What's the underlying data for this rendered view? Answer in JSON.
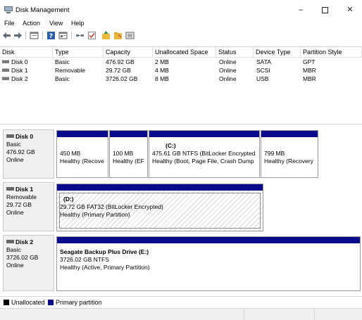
{
  "window": {
    "title": "Disk Management",
    "controls": {
      "minimize": "–",
      "close": "✕"
    }
  },
  "menu": [
    "File",
    "Action",
    "View",
    "Help"
  ],
  "toolbar": {
    "icons": [
      "back-arrow-icon",
      "forward-arrow-icon",
      "console-tree-icon",
      "help-icon",
      "properties-icon",
      "connect-icon",
      "check-icon",
      "folder-up-icon",
      "folder-icon",
      "list-view-icon"
    ]
  },
  "table": {
    "columns": [
      "Disk",
      "Type",
      "Capacity",
      "Unallocated Space",
      "Status",
      "Device Type",
      "Partition Style"
    ],
    "rows": [
      [
        "Disk 0",
        "Basic",
        "476.92 GB",
        "2 MB",
        "Online",
        "SATA",
        "GPT"
      ],
      [
        "Disk 1",
        "Removable",
        "29.72 GB",
        "4 MB",
        "Online",
        "SCSI",
        "MBR"
      ],
      [
        "Disk 2",
        "Basic",
        "3726.02 GB",
        "8 MB",
        "Online",
        "USB",
        "MBR"
      ]
    ]
  },
  "disks": [
    {
      "name": "Disk 0",
      "type": "Basic",
      "size": "476.92 GB",
      "status": "Online",
      "partitions": [
        {
          "title": "",
          "line1": "450 MB",
          "line2": "Healthy (Recove"
        },
        {
          "title": "",
          "line1": "100 MB",
          "line2": "Healthy (EF"
        },
        {
          "title": "(C:)",
          "line1": "475.61 GB NTFS (BitLocker Encrypted",
          "line2": "Healthy (Boot, Page File, Crash Dump"
        },
        {
          "title": "",
          "line1": "799 MB",
          "line2": "Healthy (Recovery"
        }
      ]
    },
    {
      "name": "Disk 1",
      "type": "Removable",
      "size": "29.72 GB",
      "status": "Online",
      "partitions": [
        {
          "title": "(D:)",
          "line1": "29.72 GB FAT32 (BitLocker Encrypted)",
          "line2": "Healthy (Primary Partition)"
        }
      ]
    },
    {
      "name": "Disk 2",
      "type": "Basic",
      "size": "3726.02 GB",
      "status": "Online",
      "partitions": [
        {
          "title": "Seagate Backup Plus Drive  (E:)",
          "line1": "3726.02 GB NTFS",
          "line2": "Healthy (Active, Primary Partition)"
        }
      ]
    }
  ],
  "legend": [
    {
      "label": "Unallocated",
      "color": "#000000"
    },
    {
      "label": "Primary partition",
      "color": "#0a0a8c"
    }
  ]
}
